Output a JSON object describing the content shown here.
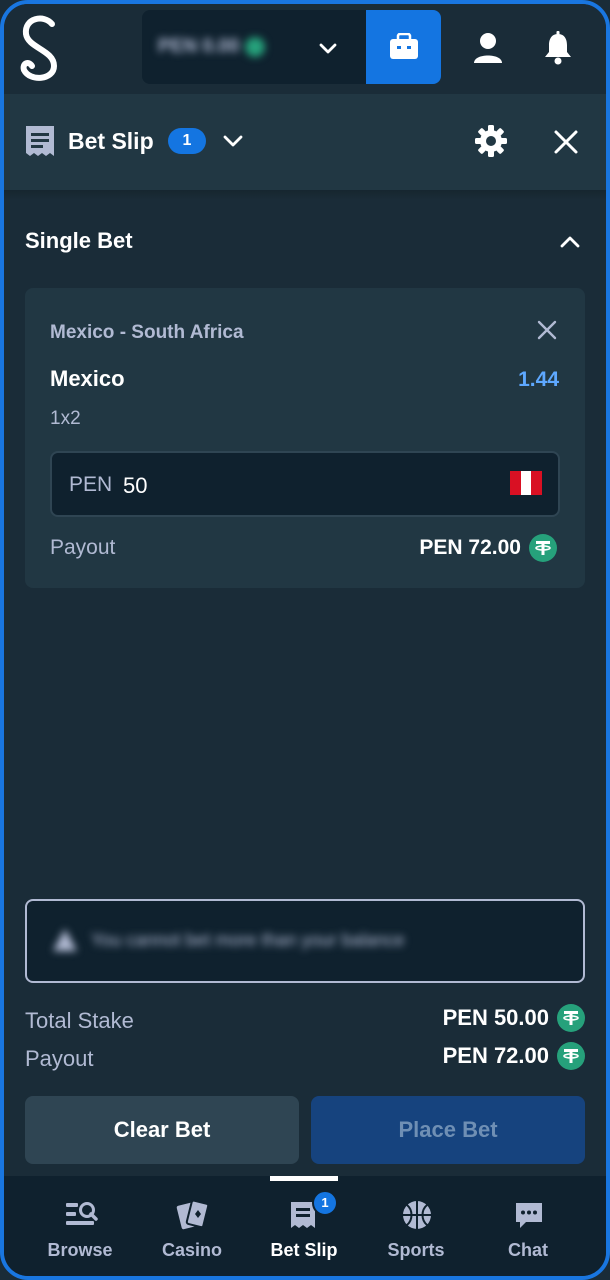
{
  "topbar": {
    "balance_text": "PEN 0.00",
    "icons": {
      "logo": "stake-s-logo",
      "wallet": "wallet-icon",
      "user": "user-icon",
      "bell": "bell-icon"
    }
  },
  "betslip": {
    "title": "Bet Slip",
    "count": "1",
    "section_title": "Single Bet",
    "bet": {
      "match": "Mexico - South Africa",
      "selection": "Mexico",
      "odds": "1.44",
      "market": "1x2",
      "stake_currency": "PEN",
      "stake_value": "50",
      "payout_label": "Payout",
      "payout_value": "PEN 72.00"
    }
  },
  "summary": {
    "notice": "You cannot bet more than your balance",
    "total_stake_label": "Total Stake",
    "total_stake_value": "PEN 50.00",
    "payout_label": "Payout",
    "payout_value": "PEN 72.00",
    "clear_label": "Clear Bet",
    "place_label": "Place Bet"
  },
  "nav": {
    "items": [
      {
        "label": "Browse",
        "icon": "browse-icon"
      },
      {
        "label": "Casino",
        "icon": "casino-cards-icon"
      },
      {
        "label": "Bet Slip",
        "icon": "betslip-icon",
        "badge": "1"
      },
      {
        "label": "Sports",
        "icon": "basketball-icon"
      },
      {
        "label": "Chat",
        "icon": "chat-icon"
      }
    ]
  },
  "colors": {
    "background": "#1a2c38",
    "panel": "#213743",
    "dark": "#0f212e",
    "accent_blue": "#1475e1",
    "odds_blue": "#5ea8ff",
    "tether_green": "#26a17b",
    "muted_text": "#b1bad3"
  }
}
